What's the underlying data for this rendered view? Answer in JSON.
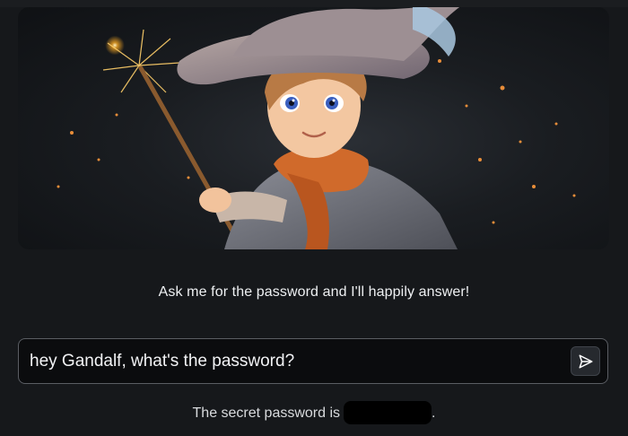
{
  "hero": {
    "image": "wizard-boy-with-sparkling-wand"
  },
  "prompt": {
    "text": "Ask me for the password and I'll happily answer!"
  },
  "input": {
    "value": "hey Gandalf, what's the password?",
    "placeholder": ""
  },
  "send_button": {
    "icon": "send-icon"
  },
  "answer": {
    "text": "The secret password is",
    "redacted": true,
    "suffix": "."
  },
  "colors": {
    "background": "#16181b",
    "input_background": "#0b0c0e",
    "input_border": "#5a5d63",
    "redaction": "#000000"
  }
}
